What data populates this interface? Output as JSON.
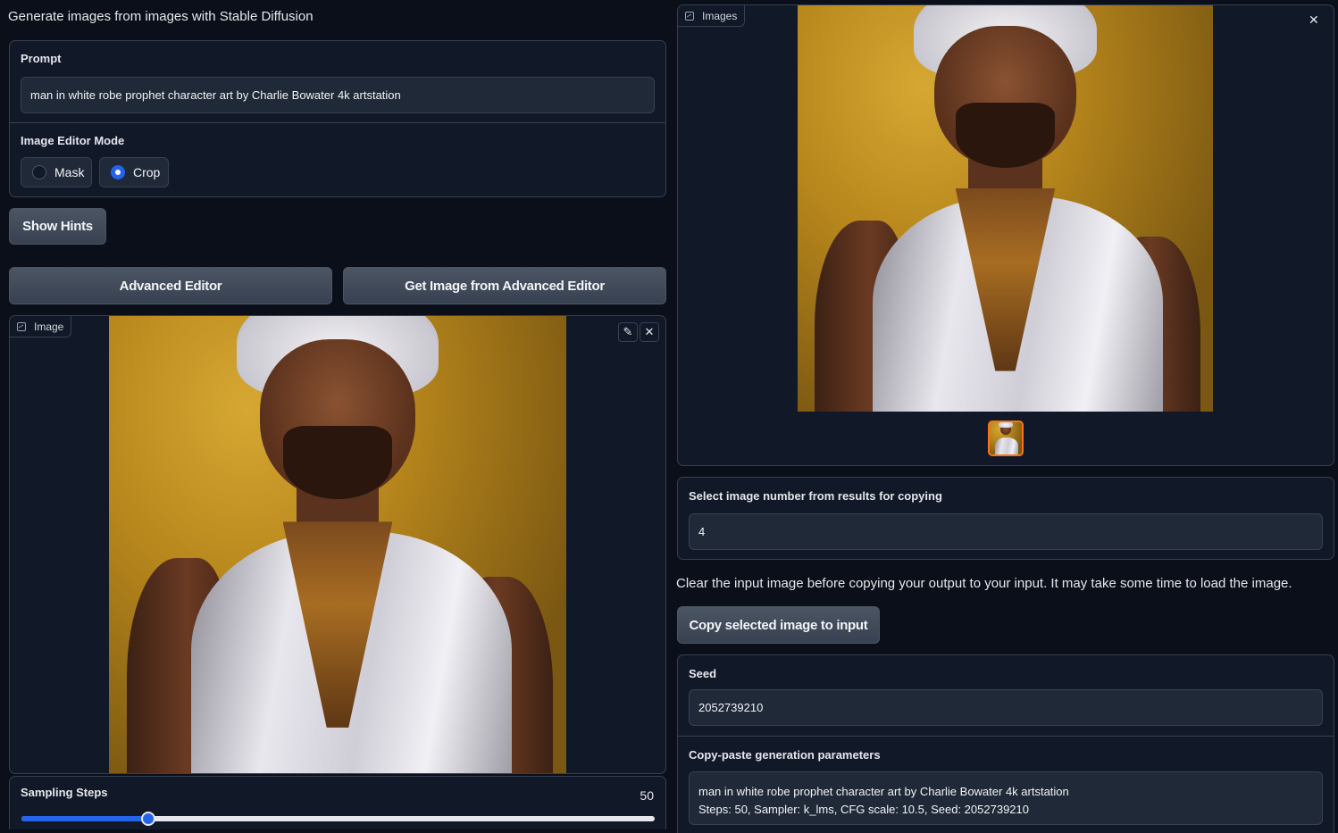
{
  "header": {
    "title": "Generate images from images with Stable Diffusion"
  },
  "prompt": {
    "label": "Prompt",
    "value": "man in white robe prophet character art by Charlie Bowater 4k artstation"
  },
  "editor_mode": {
    "label": "Image Editor Mode",
    "options": [
      {
        "label": "Mask",
        "selected": false
      },
      {
        "label": "Crop",
        "selected": true
      }
    ]
  },
  "buttons": {
    "show_hints": "Show Hints",
    "advanced_editor": "Advanced Editor",
    "get_image": "Get Image from Advanced Editor",
    "copy_selected": "Copy selected image to input"
  },
  "image_input": {
    "tag": "Image",
    "edit_icon": "pencil-icon",
    "close_icon": "close-icon"
  },
  "gallery": {
    "tag": "Images",
    "close_icon": "close-icon"
  },
  "sampling": {
    "label": "Sampling Steps",
    "value": "50",
    "fraction": 0.2
  },
  "select_image": {
    "label": "Select image number from results for copying",
    "value": "4"
  },
  "copy_note": "Clear the input image before copying your output to your input. It may take some time to load the image.",
  "seed": {
    "label": "Seed",
    "value": "2052739210"
  },
  "params": {
    "label": "Copy-paste generation parameters",
    "line1": "man in white robe prophet character art by Charlie Bowater 4k artstation",
    "line2": "Steps: 50, Sampler: k_lms, CFG scale: 10.5, Seed: 2052739210"
  },
  "colors": {
    "accent": "#2563eb",
    "thumb_border": "#f97316"
  }
}
